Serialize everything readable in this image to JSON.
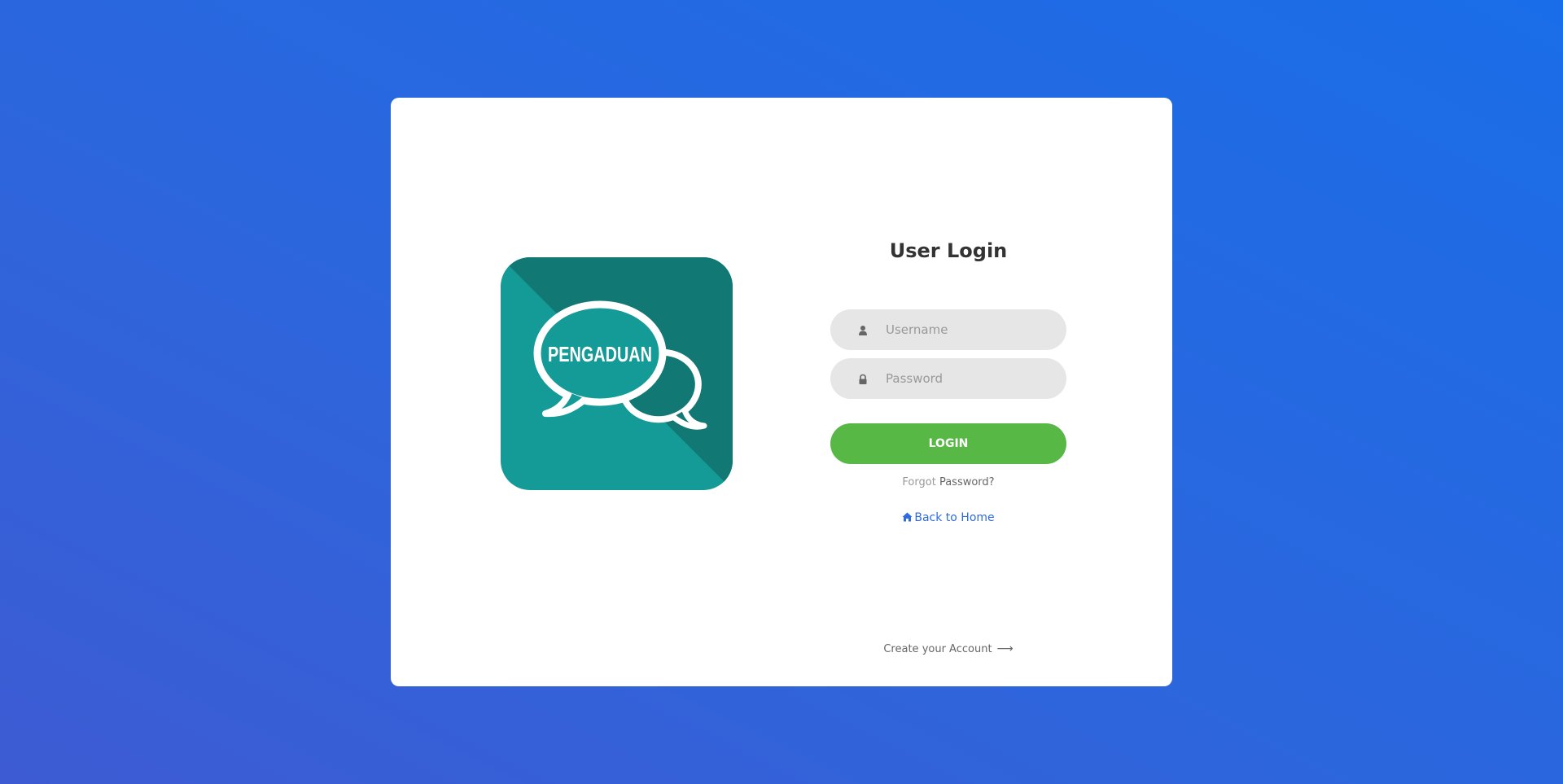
{
  "logo": {
    "text": "PENGADUAN",
    "colors": {
      "light": "#149a97",
      "dark": "#117874",
      "bubble": "#ffffff"
    }
  },
  "login": {
    "title": "User Login",
    "username_placeholder": "Username",
    "password_placeholder": "Password",
    "button_label": "LOGIN",
    "forgot_prefix": "Forgot",
    "forgot_link": "Password?",
    "home_link": "Back to Home",
    "create_account": "Create your Account",
    "create_arrow": "⟶"
  },
  "icons": {
    "username": "user-icon",
    "password": "lock-icon",
    "home": "home-icon",
    "create": "arrow-right-icon"
  },
  "colors": {
    "button": "#57b846",
    "link": "#2f6bde",
    "input_bg": "#e6e6e6"
  }
}
